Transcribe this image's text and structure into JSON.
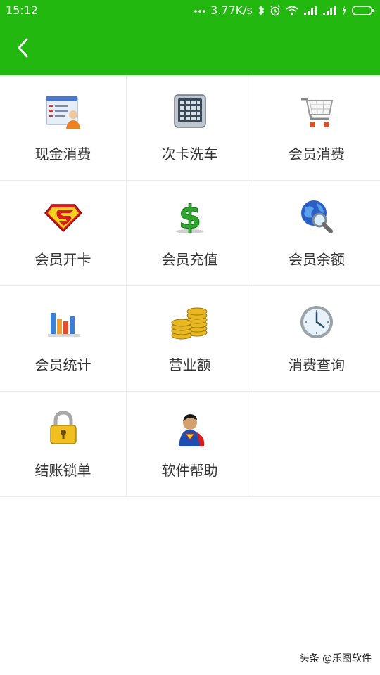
{
  "status_bar": {
    "time": "15:12",
    "network_speed": "3.77K/s",
    "icons": [
      "dots-icon",
      "bluetooth-icon",
      "alarm-icon",
      "wifi-icon",
      "signal-icon",
      "signal-icon",
      "charging-icon",
      "battery-icon"
    ]
  },
  "header": {
    "background": "#22b810",
    "back_icon": "chevron-left-icon"
  },
  "menu": {
    "items": [
      {
        "label": "现金消费",
        "icon": "cashier-icon"
      },
      {
        "label": "次卡洗车",
        "icon": "calculator-icon"
      },
      {
        "label": "会员消费",
        "icon": "shopping-cart-icon"
      },
      {
        "label": "会员开卡",
        "icon": "superman-logo-icon"
      },
      {
        "label": "会员充值",
        "icon": "dollar-icon"
      },
      {
        "label": "会员余额",
        "icon": "globe-search-icon"
      },
      {
        "label": "会员统计",
        "icon": "bar-chart-icon"
      },
      {
        "label": "营业额",
        "icon": "coins-icon"
      },
      {
        "label": "消费查询",
        "icon": "clock-icon"
      },
      {
        "label": "结账锁单",
        "icon": "padlock-icon"
      },
      {
        "label": "软件帮助",
        "icon": "superman-icon"
      }
    ]
  },
  "watermark": "头条 @乐图软件"
}
